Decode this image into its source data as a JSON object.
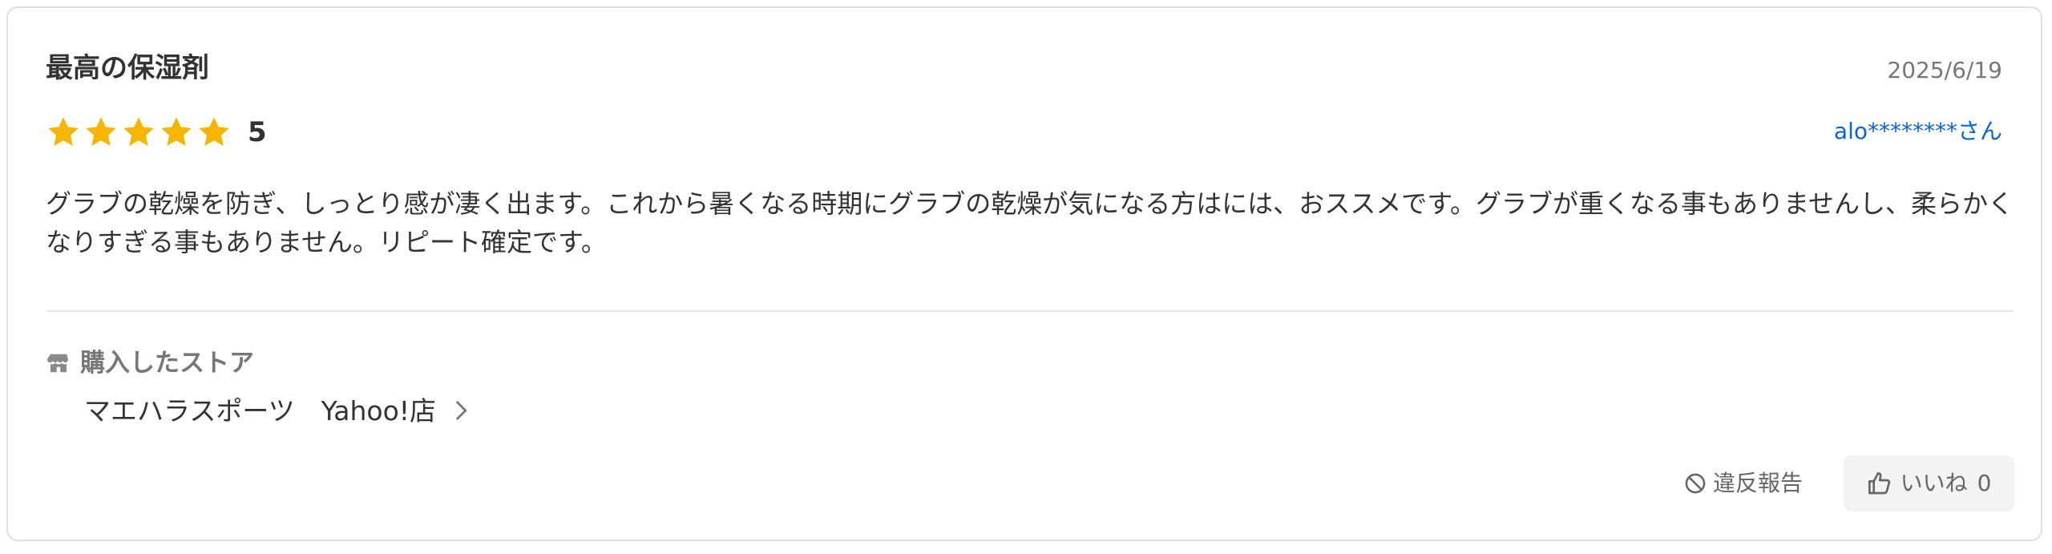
{
  "review": {
    "title": "最高の保湿剤",
    "date": "2025/6/19",
    "rating": {
      "stars": 5,
      "max_stars": 5,
      "value_text": "5",
      "star_color": "#f7b500"
    },
    "user": {
      "name": "alo********さん",
      "color": "#0b63d8"
    },
    "body": "グラブの乾燥を防ぎ、しっとり感が凄く出ます。これから暑くなる時期にグラブの乾燥が気になる方はには、おススメです。グラブが重くなる事もありませんし、柔らかくなりすぎる事もありません。リピート確定です。"
  },
  "store": {
    "heading": "購入したストア",
    "icon": "store-icon",
    "name": "マエハラスポーツ　Yahoo!店",
    "link_icon": "chevron-right-icon"
  },
  "actions": {
    "report": {
      "label": "違反報告",
      "icon": "prohibit-icon"
    },
    "like": {
      "label": "いいね",
      "count": "0",
      "icon": "thumbs-up-icon"
    }
  }
}
